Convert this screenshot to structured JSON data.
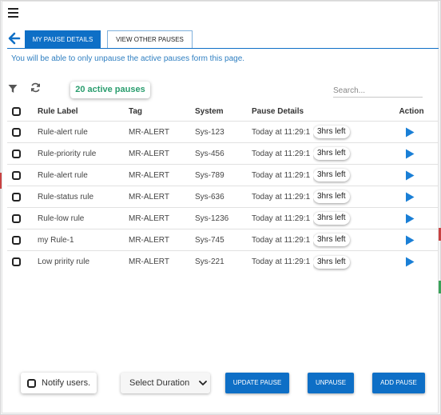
{
  "header": {
    "menu_icon": "hamburger-menu-icon",
    "back_icon": "arrow-left-icon"
  },
  "tabs": [
    {
      "label": "MY PAUSE DETAILS",
      "active": true
    },
    {
      "label": "VIEW OTHER PAUSES",
      "active": false
    }
  ],
  "info_text": "You will be able to only unpause the active pauses form this page.",
  "toolbar": {
    "filter_icon": "filter-icon",
    "refresh_icon": "refresh-icon",
    "active_count_label": "20 active pauses",
    "search_placeholder": "Search...",
    "search_value": ""
  },
  "table": {
    "columns": [
      "Rule Label",
      "Tag",
      "System",
      "Pause Details",
      "Action"
    ],
    "rows": [
      {
        "label": "Rule-alert rule",
        "tag": "MR-ALERT",
        "system": "Sys-123",
        "pause": "Today at 11:29:1",
        "left": "3hrs left"
      },
      {
        "label": "Rule-priority rule",
        "tag": "MR-ALERT",
        "system": "Sys-456",
        "pause": "Today at 11:29:1",
        "left": "3hrs left"
      },
      {
        "label": "Rule-alert rule",
        "tag": "MR-ALERT",
        "system": "Sys-789",
        "pause": "Today at 11:29:1",
        "left": "3hrs left"
      },
      {
        "label": "Rule-status rule",
        "tag": "MR-ALERT",
        "system": "Sys-636",
        "pause": "Today at 11:29:1",
        "left": "3hrs left"
      },
      {
        "label": "Rule-low rule",
        "tag": "MR-ALERT",
        "system": "Sys-1236",
        "pause": "Today at 11:29:1",
        "left": "3hrs left"
      },
      {
        "label": "my Rule-1",
        "tag": "MR-ALERT",
        "system": "Sys-745",
        "pause": "Today at 11:29:1",
        "left": "3hrs left"
      },
      {
        "label": "Low pririty rule",
        "tag": "MR-ALERT",
        "system": "Sys-221",
        "pause": "Today at 11:29:1",
        "left": "3hrs left"
      }
    ],
    "action_icon": "play-icon"
  },
  "footer": {
    "notify_label": "Notify users.",
    "duration_selected": "Select Duration",
    "update_label": "UPDATE PAUSE",
    "unpause_label": "UNPAUSE",
    "add_label": "ADD PAUSE"
  },
  "colors": {
    "primary": "#0e6fc6",
    "info_text": "#2f7fc1",
    "active_badge_text": "#2a9d6e",
    "play_icon": "#1a7fd6"
  }
}
